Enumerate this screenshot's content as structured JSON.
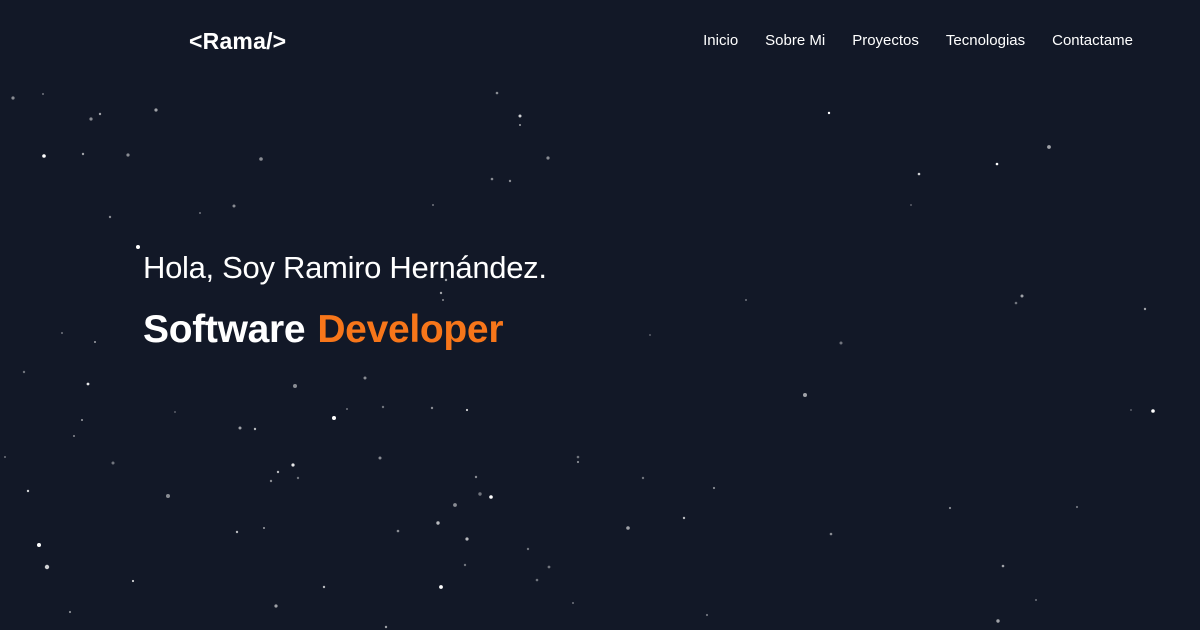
{
  "logo": "<Rama/>",
  "nav": {
    "items": [
      "Inicio",
      "Sobre Mi",
      "Proyectos",
      "Tecnologias",
      "Contactame"
    ]
  },
  "hero": {
    "greeting": "Hola, Soy Ramiro Hernández.",
    "role_first": "Software",
    "role_second": "Developer"
  },
  "colors": {
    "background": "#121827",
    "accent": "#f7761a",
    "text": "#ffffff"
  }
}
